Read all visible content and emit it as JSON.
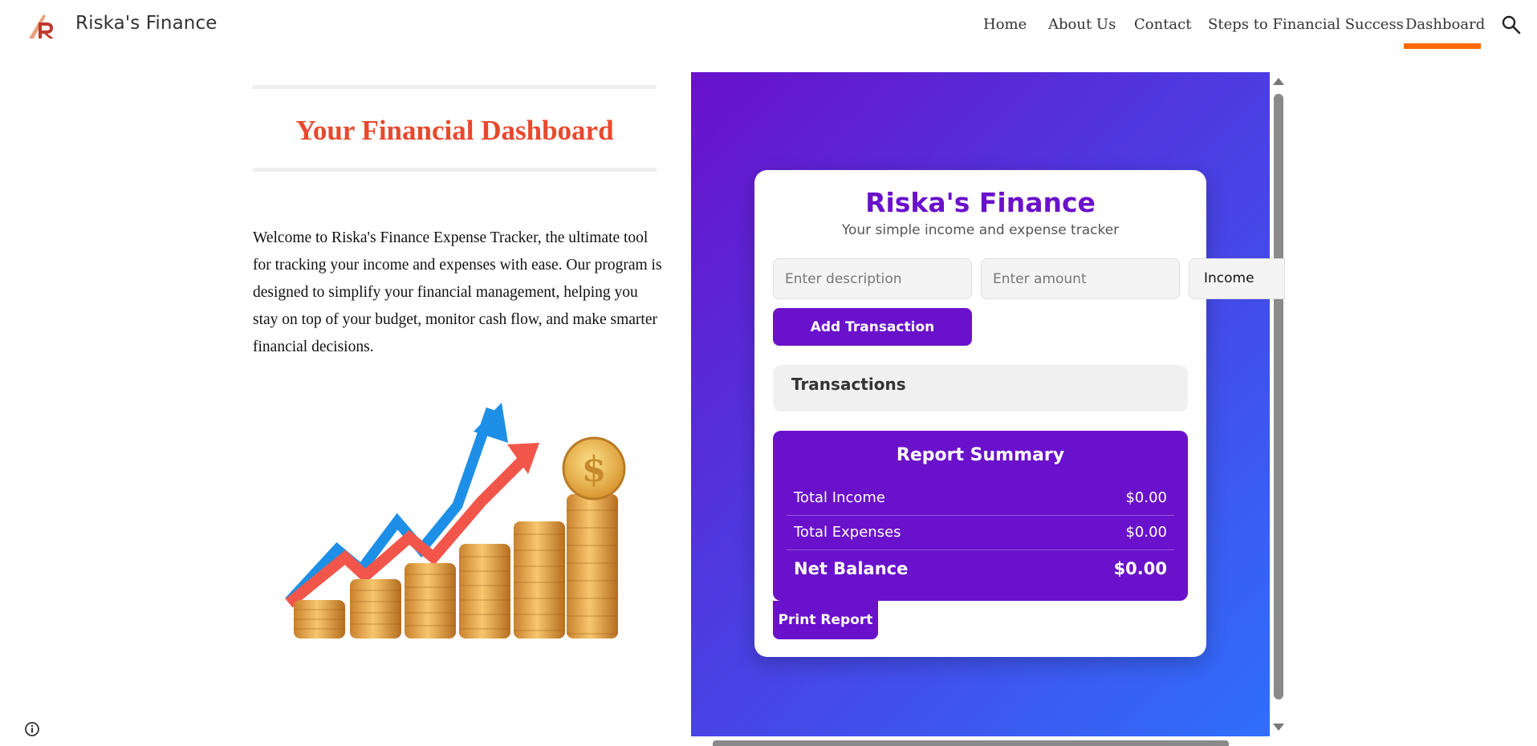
{
  "site": {
    "title": "Riska's Finance",
    "logo_icon": "riska-logo-icon"
  },
  "nav": {
    "items": [
      {
        "label": "Home"
      },
      {
        "label": "About Us"
      },
      {
        "label": "Contact"
      },
      {
        "label": "Steps to Financial Success"
      },
      {
        "label": "Dashboard"
      }
    ],
    "active": "Dashboard",
    "active_color": "#ff6a00",
    "search_icon": "search-icon"
  },
  "page": {
    "heading": "Your Financial Dashboard",
    "heading_color": "#e8492d",
    "intro": "Welcome to Riska's Finance Expense Tracker, the ultimate tool for tracking your income and expenses with ease. Our program is designed to simplify your financial management, helping you stay on top of your budget, monitor cash flow, and make smarter financial decisions.",
    "image_icon": "coins-growth-chart-image"
  },
  "app": {
    "title": "Riska's Finance",
    "subtitle": "Your simple income and expense tracker",
    "accent": "#6a11cb",
    "description_placeholder": "Enter description",
    "amount_placeholder": "Enter amount",
    "type_selected": "Income",
    "add_button": "Add Transaction",
    "transactions_heading": "Transactions",
    "report": {
      "title": "Report Summary",
      "rows": [
        {
          "label": "Total Income",
          "value": "$0.00"
        },
        {
          "label": "Total Expenses",
          "value": "$0.00"
        },
        {
          "label": "Net Balance",
          "value": "$0.00"
        }
      ]
    },
    "print_button": "Print Report"
  },
  "footer": {
    "info_icon": "info-icon"
  }
}
